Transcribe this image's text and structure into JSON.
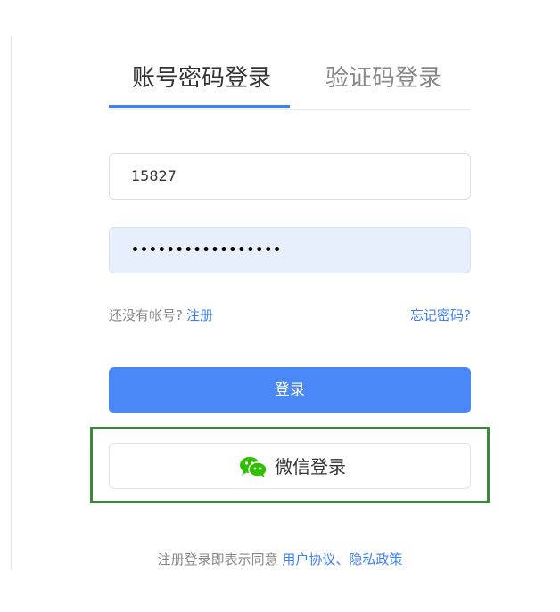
{
  "tabs": {
    "account_login": "账号密码登录",
    "code_login": "验证码登录",
    "active": "account_login"
  },
  "form": {
    "username_value": "15827",
    "password_value": "•••••••••••••••••"
  },
  "links": {
    "no_account_text": "还没有帐号?",
    "register": "注册",
    "forgot_password": "忘记密码?"
  },
  "buttons": {
    "login": "登录",
    "wechat_login": "微信登录"
  },
  "agreement": {
    "prefix": "注册登录即表示同意",
    "user_agreement": "用户协议",
    "separator": "、",
    "privacy_policy": "隐私政策"
  },
  "colors": {
    "accent": "#3f7ff5",
    "login_button": "#4a88f7",
    "wechat_green": "#2dc100",
    "highlight_border": "#3a8a3a"
  }
}
